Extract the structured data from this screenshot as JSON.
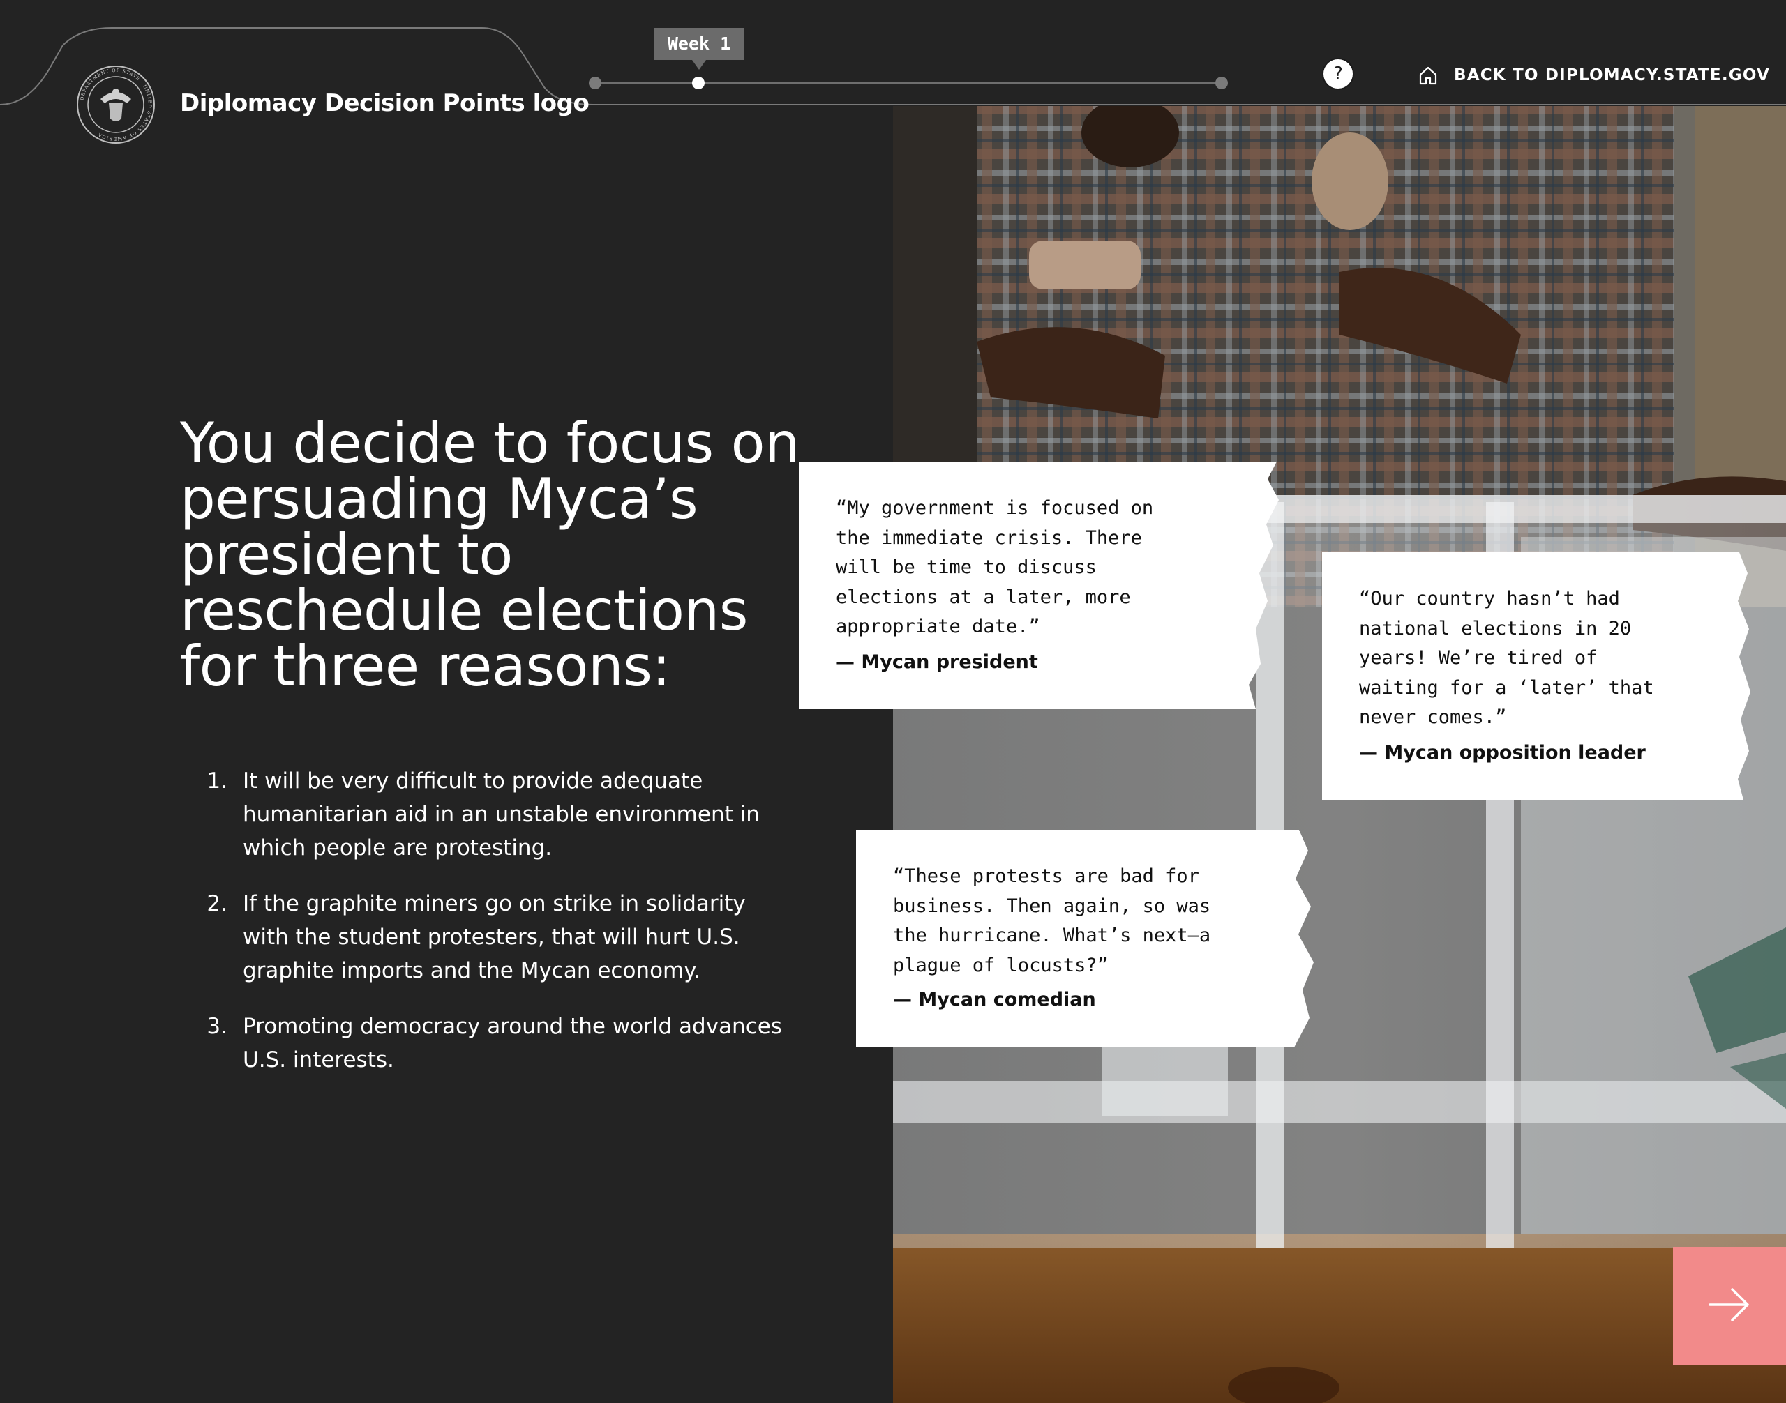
{
  "header": {
    "logo_text": "Diplomacy Decision Points logo",
    "seal_text": "DEPARTMENT OF STATE · UNITED STATES OF AMERICA",
    "week_label": "Week 1",
    "help_label": "?",
    "back_link_label": "BACK TO DIPLOMACY.STATE.GOV",
    "timeline_steps": 3,
    "timeline_active_step": 2
  },
  "main": {
    "heading": "You decide to focus on persuading Myca’s president to reschedule elections for three reasons:",
    "reasons": [
      {
        "num": "1.",
        "text": "It will be very difficult to provide adequate humanitarian aid in an unstable environment in which people are protesting."
      },
      {
        "num": "2.",
        "text": "If the graphite miners go on strike in solidarity with the student protesters, that will hurt U.S. graphite imports and the Mycan economy."
      },
      {
        "num": "3.",
        "text": "Promoting democracy around the world advances U.S. interests."
      }
    ]
  },
  "quotes": [
    {
      "text": "“My government is focused on\nthe immediate crisis. There\nwill be time to discuss\nelections at a later, more\nappropriate date.”",
      "attribution": "— Mycan president"
    },
    {
      "text": "“Our country hasn’t had\nnational elections in 20\nyears! We’re tired of\nwaiting for a ‘later’ that\nnever comes.”",
      "attribution": "— Mycan opposition leader"
    },
    {
      "text": "“These protests are bad for\nbusiness. Then again, so was\nthe hurricane. What’s next—a\nplague of locusts?”",
      "attribution": "— Mycan comedian"
    }
  ],
  "icons": {
    "seal": "department-of-state-seal-icon",
    "help": "question-mark-icon",
    "home": "home-icon",
    "next": "arrow-right-icon"
  },
  "colors": {
    "background": "#232323",
    "next_button": "#f28a8a",
    "week_tag": "#6b6b6b",
    "quote_card": "#ffffff"
  }
}
